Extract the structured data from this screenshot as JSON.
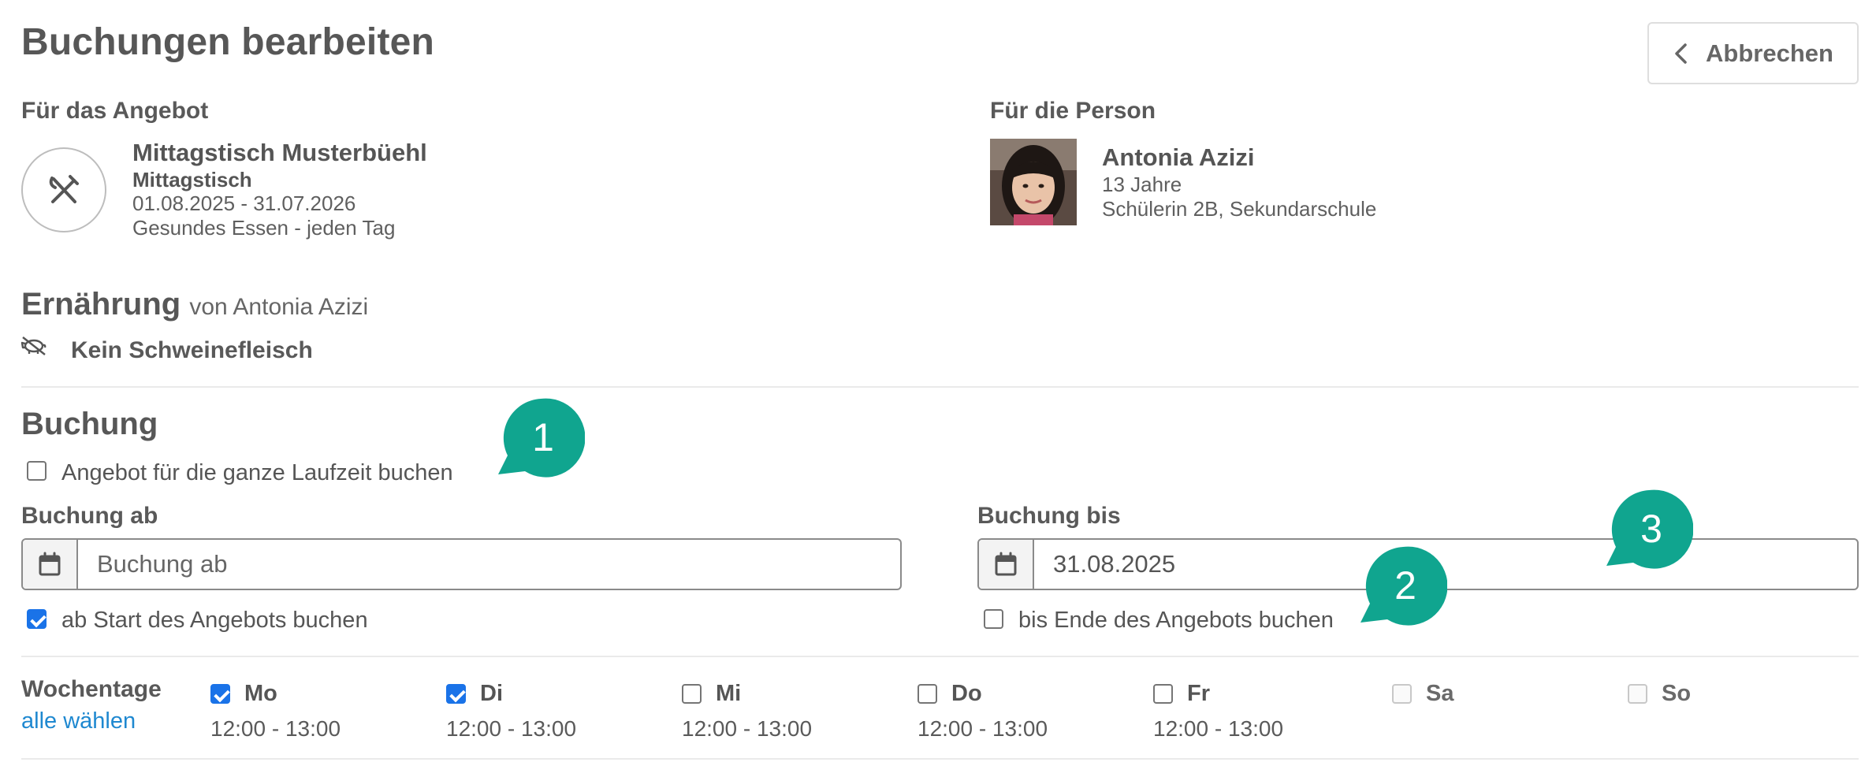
{
  "header": {
    "title": "Buchungen bearbeiten",
    "cancel_label": "Abbrechen"
  },
  "offer": {
    "section_label": "Für das Angebot",
    "icon": "cutlery-icon",
    "name": "Mittagstisch Musterbüehl",
    "type": "Mittagstisch",
    "period": "01.08.2025 - 31.07.2026",
    "description": "Gesundes Essen - jeden Tag"
  },
  "person": {
    "section_label": "Für die Person",
    "name": "Antonia Azizi",
    "age": "13 Jahre",
    "role": "Schülerin 2B, Sekundarschule"
  },
  "nutrition": {
    "title": "Ernährung",
    "subtitle": "von Antonia Azizi",
    "item_icon": "no-pork-icon",
    "item": "Kein Schweinefleisch"
  },
  "booking": {
    "title": "Buchung",
    "whole_period_label": "Angebot für die ganze Laufzeit buchen",
    "whole_period_checked": false,
    "from": {
      "label": "Buchung ab",
      "placeholder": "Buchung ab",
      "value": "",
      "checkbox_label": "ab Start des Angebots buchen",
      "checked": true
    },
    "to": {
      "label": "Buchung bis",
      "placeholder": "Buchung bis",
      "value": "31.08.2025",
      "checkbox_label": "bis Ende des Angebots buchen",
      "checked": false
    }
  },
  "weekdays": {
    "label": "Wochentage",
    "select_all": "alle wählen",
    "days": [
      {
        "label": "Mo",
        "time": "12:00 - 13:00",
        "checked": true,
        "disabled": false
      },
      {
        "label": "Di",
        "time": "12:00 - 13:00",
        "checked": true,
        "disabled": false
      },
      {
        "label": "Mi",
        "time": "12:00 - 13:00",
        "checked": false,
        "disabled": false
      },
      {
        "label": "Do",
        "time": "12:00 - 13:00",
        "checked": false,
        "disabled": false
      },
      {
        "label": "Fr",
        "time": "12:00 - 13:00",
        "checked": false,
        "disabled": false
      },
      {
        "label": "Sa",
        "time": "",
        "checked": false,
        "disabled": true
      },
      {
        "label": "So",
        "time": "",
        "checked": false,
        "disabled": true
      }
    ]
  },
  "callouts": {
    "one": "1",
    "two": "2",
    "three": "3",
    "color": "#10a58f"
  },
  "colors": {
    "link": "#1e88d0",
    "checkbox": "#1a73e8",
    "text": "#555555"
  }
}
